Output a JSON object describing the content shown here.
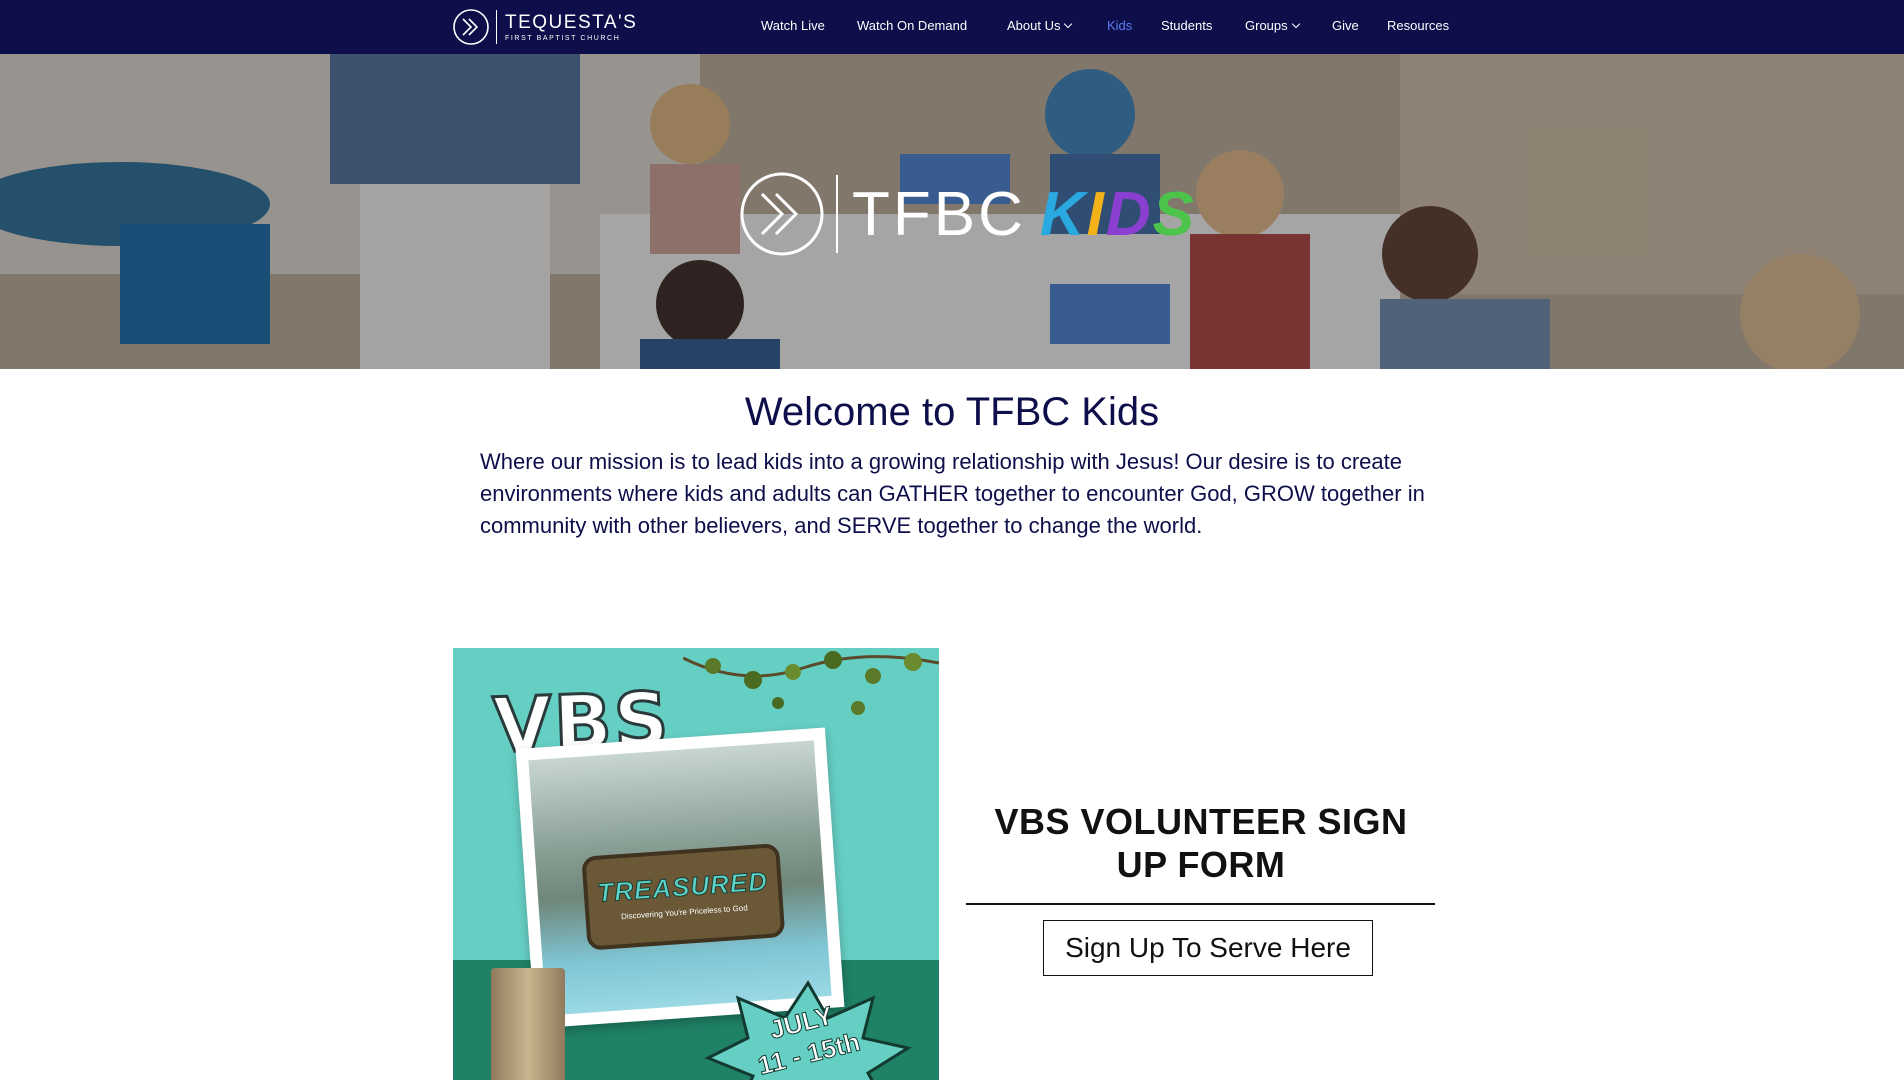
{
  "nav": {
    "brand": "TEQUESTA'S",
    "brand_sub": "FIRST BAPTIST CHURCH",
    "items": [
      {
        "label": "Watch Live"
      },
      {
        "label": "Watch On Demand"
      },
      {
        "label": "About Us",
        "has_dropdown": true
      },
      {
        "label": "Kids",
        "active": true
      },
      {
        "label": "Students"
      },
      {
        "label": "Groups",
        "has_dropdown": true
      },
      {
        "label": "Give"
      },
      {
        "label": "Resources"
      }
    ]
  },
  "hero": {
    "logo_tfbc": "TFBC",
    "logo_kids": [
      "K",
      "I",
      "D",
      "S"
    ]
  },
  "welcome": {
    "title": "Welcome to TFBC Kids",
    "text": "Where our mission is to lead kids into a growing relationship with Jesus! Our desire is to create environments where kids and adults can GATHER together to encounter God, GROW together in community with other believers, and SERVE together to change the world."
  },
  "vbs": {
    "poster_title": "VBS",
    "poster_theme": "TREASURED",
    "poster_tagline": "Discovering You're Priceless to God",
    "poster_date": "JULY\n11 - 15th",
    "heading": "VBS VOLUNTEER SIGN UP FORM",
    "button_label": "Sign Up To Serve Here"
  },
  "colors": {
    "nav_bg": "#0d0e4a",
    "nav_active": "#5b7cf0",
    "heading_text": "#0d0e4a",
    "poster_teal": "#66cfc4",
    "poster_green": "#1f8166"
  }
}
